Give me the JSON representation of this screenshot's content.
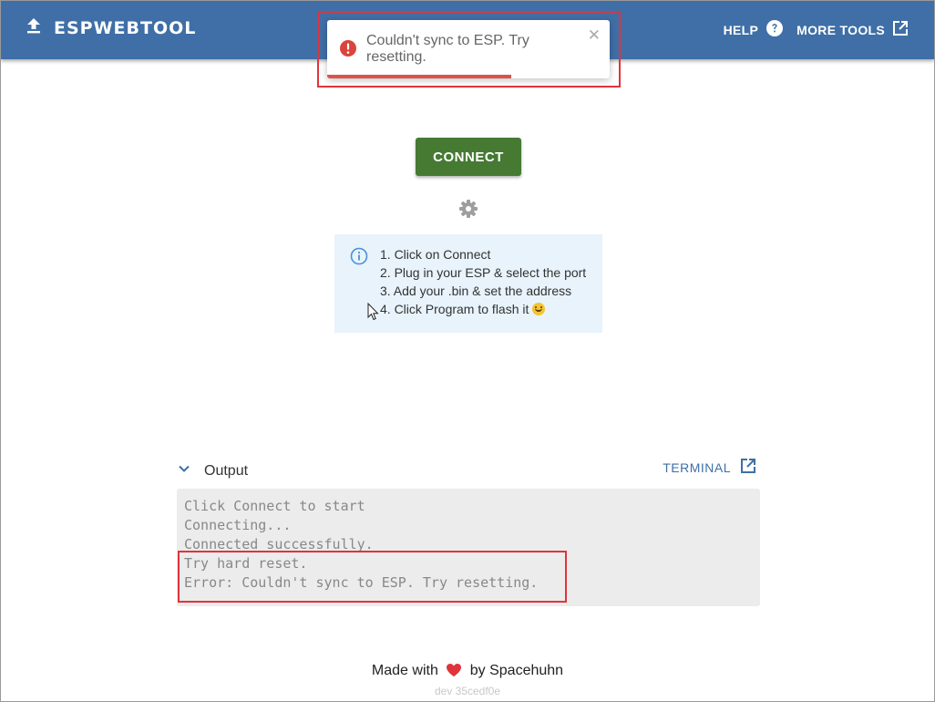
{
  "header": {
    "title": "ESPWEBTOOL",
    "help_label": "HELP",
    "more_tools_label": "MORE TOOLS",
    "background_color": "#3f6fa6"
  },
  "toast": {
    "message": "Couldn't sync to ESP. Try resetting.",
    "progress_fraction": 0.65,
    "type": "error",
    "icon": "exclamation-circle-icon"
  },
  "main": {
    "connect_label": "CONNECT",
    "connect_color": "#467a33"
  },
  "instructions": {
    "steps": [
      "1. Click on Connect",
      "2. Plug in your ESP & select the port",
      "3. Add your .bin & set the address",
      "4. Click Program to flash it"
    ],
    "emoji": "smiling-face"
  },
  "output": {
    "label": "Output",
    "terminal_label": "TERMINAL",
    "lines": [
      "Click Connect to start",
      "Connecting...",
      "Connected successfully.",
      "Try hard reset.",
      "Error: Couldn't sync to ESP. Try resetting."
    ]
  },
  "footer": {
    "made_with": "Made with",
    "by_text": "by Spacehuhn",
    "version": "dev 35cedf0e"
  }
}
